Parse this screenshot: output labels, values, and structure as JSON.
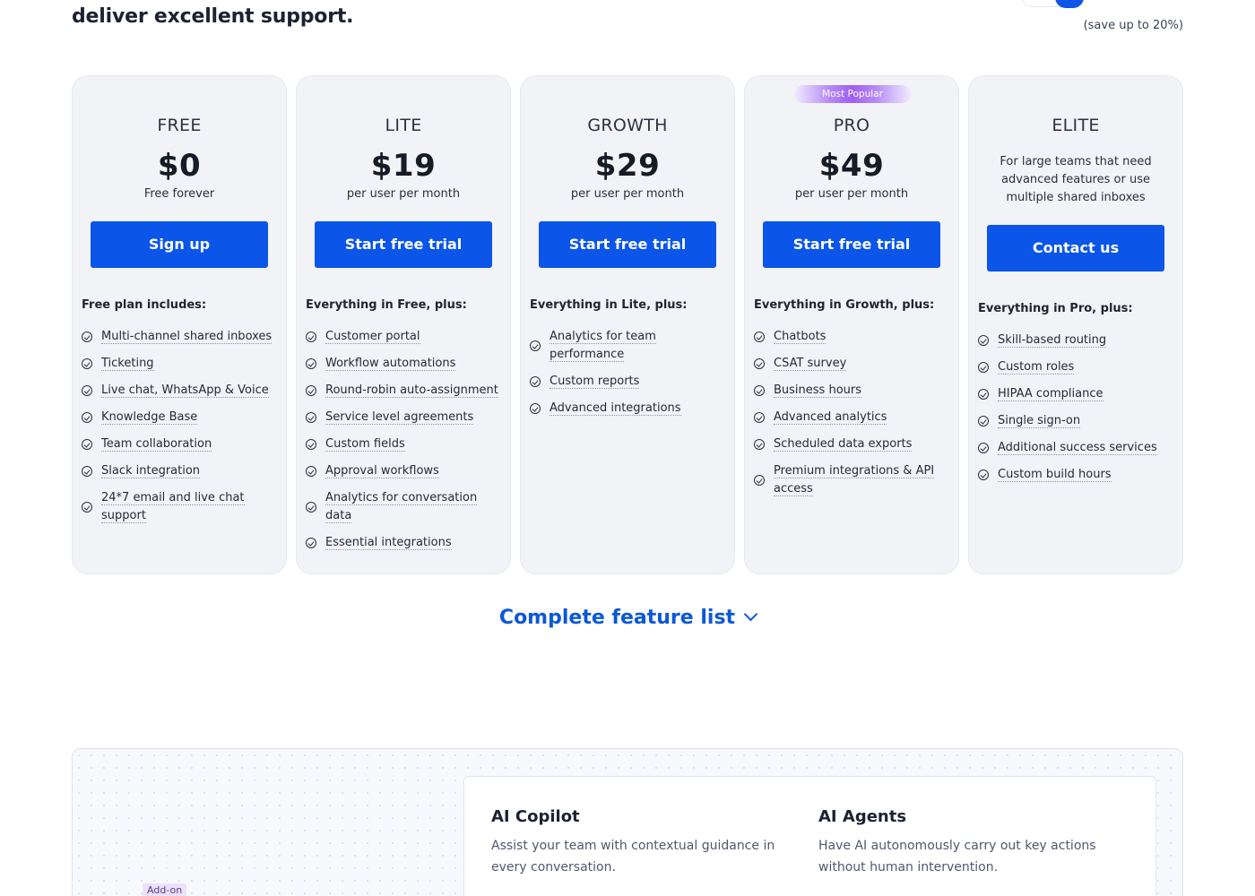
{
  "header": {
    "headline": "deliver excellent support.",
    "save_note": "(save up to 20%)"
  },
  "plans": [
    {
      "name": "FREE",
      "price": "$0",
      "price_sub": "Free forever",
      "cta": "Sign up",
      "includes": "Free plan includes:",
      "features": [
        "Multi-channel shared inboxes",
        "Ticketing",
        "Live chat, WhatsApp & Voice",
        "Knowledge Base",
        "Team collaboration",
        "Slack integration",
        "24*7 email and live chat support"
      ]
    },
    {
      "name": "LITE",
      "price": "$19",
      "price_sub": "per user per month",
      "cta": "Start free trial",
      "includes": "Everything in Free, plus:",
      "features": [
        "Customer portal",
        "Workflow automations",
        "Round-robin auto-assignment",
        "Service level agreements",
        "Custom fields",
        "Approval workflows",
        "Analytics for conversation data",
        "Essential integrations"
      ]
    },
    {
      "name": "GROWTH",
      "price": "$29",
      "price_sub": "per user per month",
      "cta": "Start free trial",
      "includes": "Everything in Lite, plus:",
      "features": [
        "Analytics for team performance",
        "Custom reports",
        "Advanced integrations"
      ]
    },
    {
      "name": "PRO",
      "badge": "Most Popular",
      "price": "$49",
      "price_sub": "per user per month",
      "cta": "Start free trial",
      "includes": "Everything in Growth, plus:",
      "features": [
        "Chatbots",
        "CSAT survey",
        "Business hours",
        "Advanced analytics",
        "Scheduled data exports",
        "Premium integrations & API access"
      ]
    },
    {
      "name": "ELITE",
      "description": "For large teams that need advanced features or use multiple shared inboxes",
      "cta": "Contact us",
      "includes": "Everything in Pro, plus:",
      "features": [
        "Skill-based routing",
        "Custom roles",
        "HIPAA compliance",
        "Single sign-on",
        "Additional success services",
        "Custom build hours"
      ]
    }
  ],
  "feature_link": {
    "label": "Complete feature list",
    "icon": "chevron-down-icon"
  },
  "addons": {
    "tag": "Add-on",
    "items": [
      {
        "title": "AI Copilot",
        "description": "Assist your team with contextual guidance in every conversation."
      },
      {
        "title": "AI Agents",
        "description": "Have AI autonomously carry out key actions without human intervention."
      }
    ]
  },
  "colors": {
    "primary": "#0b55e8",
    "link": "#0c58d6",
    "card_bg": "#f2f3f7",
    "badge_purple": "#a05ef0"
  }
}
